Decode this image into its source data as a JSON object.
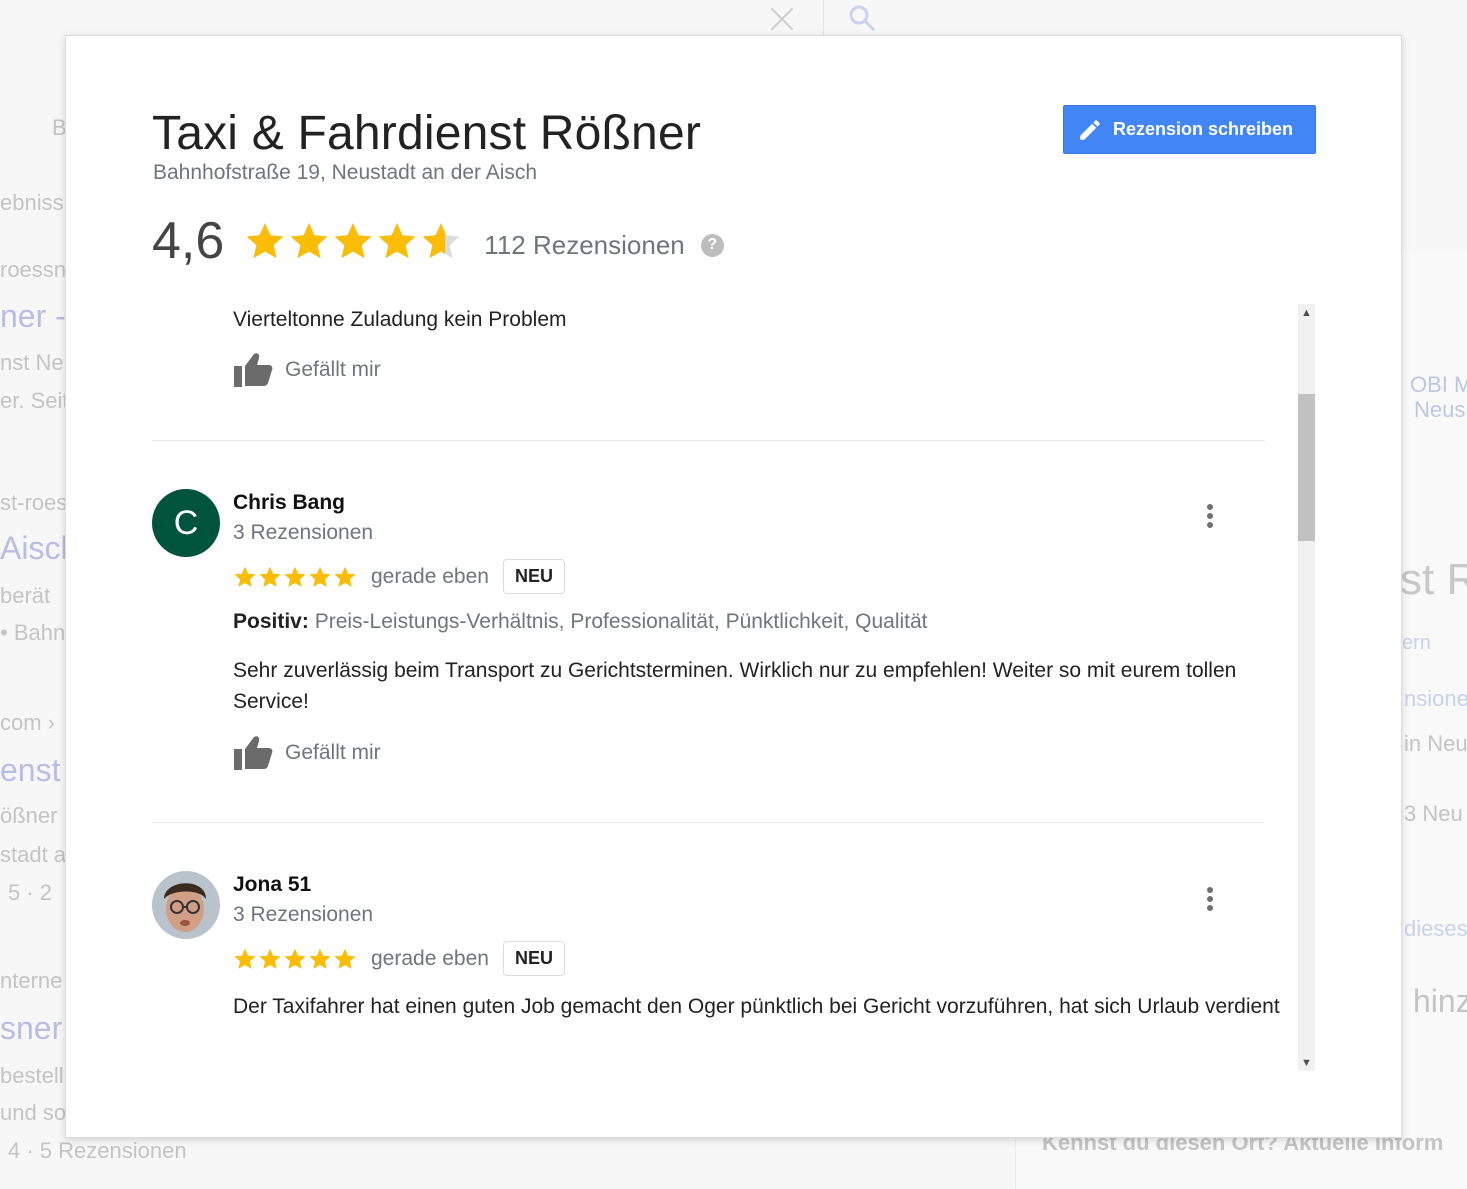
{
  "background": {
    "left_fragments": [
      "B",
      "ebniss",
      "roessn",
      "ner -",
      "nst Ne",
      "er. Seit",
      "st-roes",
      "Aisch",
      "berät",
      "• Bahn",
      "com ›",
      "enst",
      "ößner",
      "stadt a",
      "5 · 2",
      "nterne",
      "sner",
      "bestell",
      "und so",
      "4 · 5 Rezensionen"
    ],
    "right_fragments": [
      "OBI M",
      "Neus",
      "st R",
      "ern",
      "nsione",
      "in Neu",
      "3 Neu",
      "dieses",
      "hinz",
      "Kennst du diesen Ort? Aktuelle Inform"
    ]
  },
  "dialog": {
    "title": "Taxi & Fahrdienst Rößner",
    "address": "Bahnhofstraße 19, Neustadt an der Aisch",
    "write_review_label": "Rezension schreiben",
    "rating_value": "4,6",
    "rating_stars": 4.6,
    "review_count_label": "112 Rezensionen",
    "help_icon": "?"
  },
  "reviews": {
    "partial": {
      "text": "Vierteltonne Zuladung kein Problem",
      "like_label": "Gefällt mir"
    },
    "items": [
      {
        "avatar_letter": "C",
        "author": "Chris Bang",
        "author_sub": "3 Rezensionen",
        "stars": 5,
        "time": "gerade eben",
        "badge": "NEU",
        "positive_label": "Positiv:",
        "positive_text": "Preis-Leistungs-Verhältnis, Professionalität, Pünktlichkeit, Qualität",
        "text": "Sehr zuverlässig beim Transport zu Gerichtsterminen. Wirklich nur zu empfehlen! Weiter so mit eurem tollen Service!",
        "like_label": "Gefällt mir"
      },
      {
        "avatar_letter": "",
        "author": "Jona 51",
        "author_sub": "3 Rezensionen",
        "stars": 5,
        "time": "gerade eben",
        "badge": "NEU",
        "text": "Der Taxifahrer hat einen guten Job gemacht den Oger pünktlich bei Gericht vorzuführen, hat sich Urlaub verdient"
      }
    ]
  },
  "colors": {
    "accent": "#4285f4",
    "star": "#fbbc04",
    "avatar_c": "#00543b"
  }
}
